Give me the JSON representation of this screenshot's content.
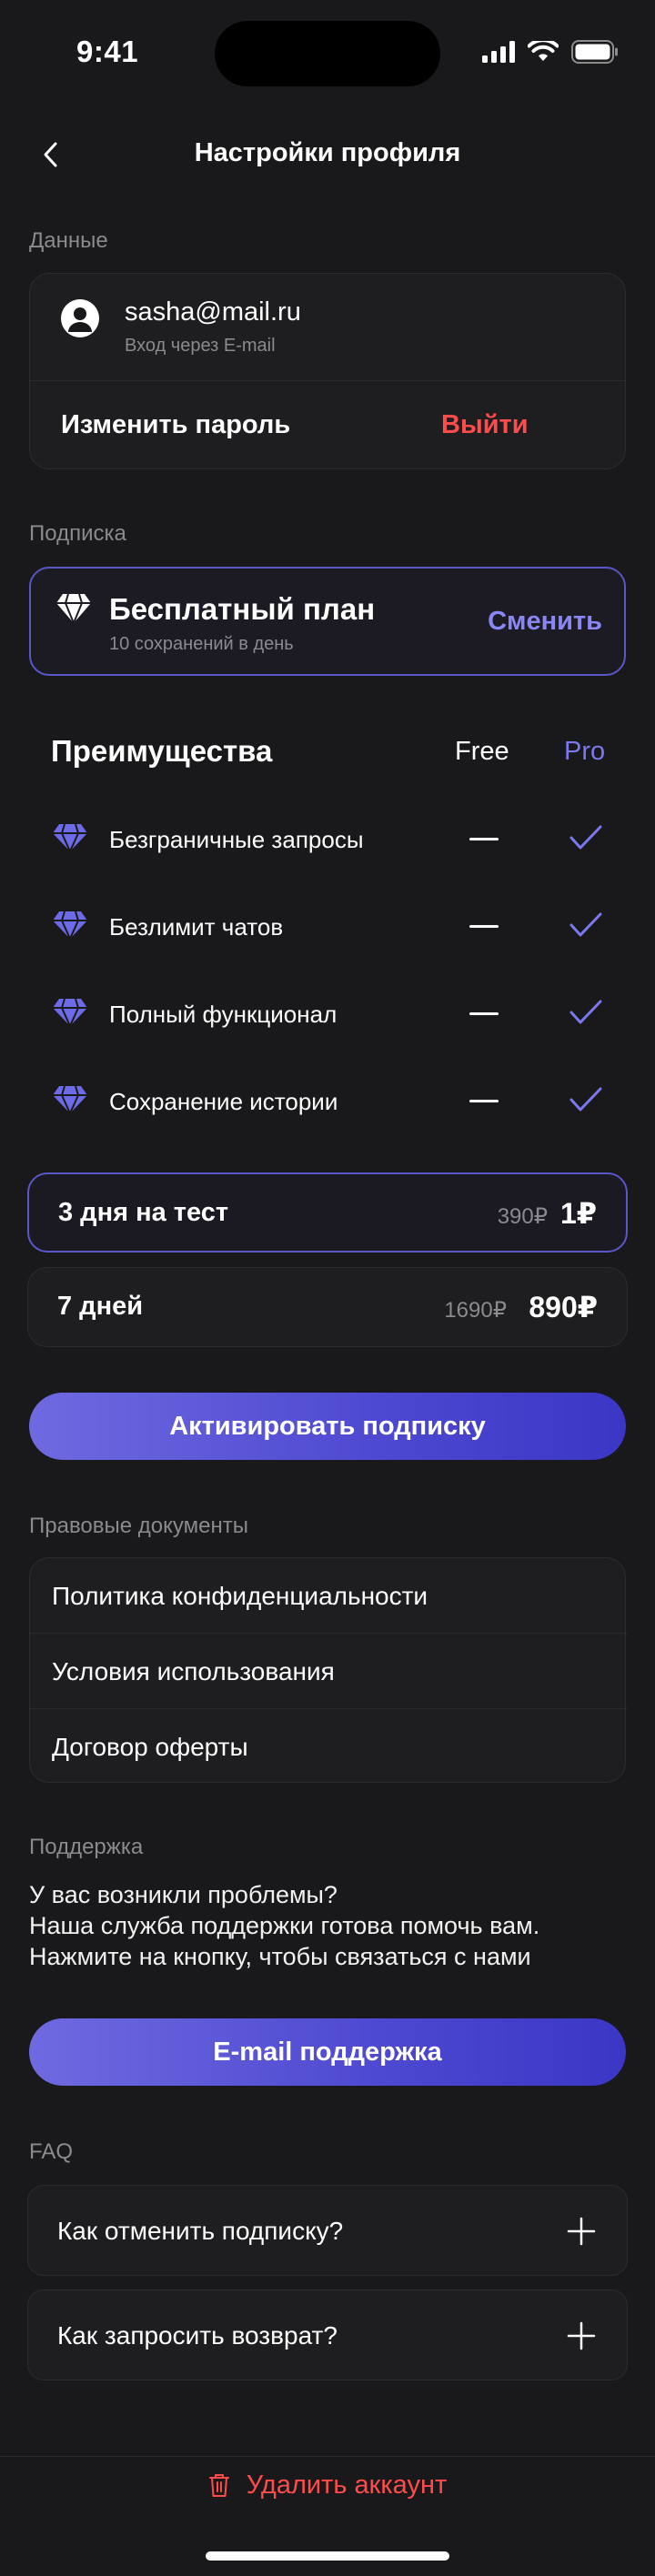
{
  "status_bar": {
    "time": "9:41"
  },
  "header": {
    "title": "Настройки профиля"
  },
  "sections": {
    "data": "Данные",
    "subscription": "Подписка",
    "legal": "Правовые документы",
    "support": "Поддержка",
    "faq": "FAQ"
  },
  "account": {
    "email": "sasha@mail.ru",
    "login_method": "Вход через E-mail",
    "change_password": "Изменить пароль",
    "logout": "Выйти"
  },
  "plan": {
    "title": "Бесплатный план",
    "subtitle": "10 сохранений в день",
    "change": "Сменить"
  },
  "benefits": {
    "title": "Преимущества",
    "col_free": "Free",
    "col_pro": "Pro",
    "items": [
      {
        "label": "Безграничные запросы"
      },
      {
        "label": "Безлимит чатов"
      },
      {
        "label": "Полный функционал"
      },
      {
        "label": "Сохранение истории"
      }
    ]
  },
  "prices": [
    {
      "label": "3 дня на тест",
      "old": "390₽",
      "new": "1₽",
      "selected": true
    },
    {
      "label": "7 дней",
      "old": "1690₽",
      "new": "890₽",
      "selected": false
    }
  ],
  "activate_button": "Активировать подписку",
  "legal_docs": [
    {
      "label": "Политика конфиденциальности"
    },
    {
      "label": "Условия использования"
    },
    {
      "label": "Договор оферты"
    }
  ],
  "support": {
    "line1": "У вас возникли проблемы?",
    "line2": "Наша служба поддержки готова помочь вам.",
    "line3": "Нажмите на кнопку, чтобы связаться с нами",
    "button": "E-mail поддержка"
  },
  "faq": [
    {
      "question": "Как отменить подписку?"
    },
    {
      "question": "Как запросить возврат?"
    }
  ],
  "delete_account": "Удалить аккаунт",
  "colors": {
    "background": "#19181a",
    "accent": "#5a57c7",
    "accent_text": "#8a87f5",
    "danger": "#ff4b4b"
  }
}
